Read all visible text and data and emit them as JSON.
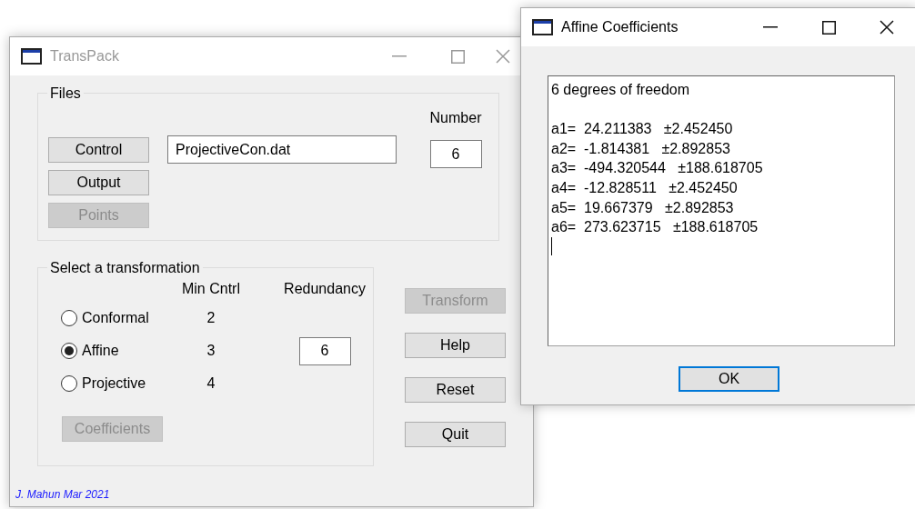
{
  "main_window": {
    "title": "TransPack",
    "active": false,
    "files_group": {
      "legend": "Files",
      "buttons": [
        {
          "label": "Control",
          "disabled": false
        },
        {
          "label": "Output",
          "disabled": false
        },
        {
          "label": "Points",
          "disabled": true
        }
      ],
      "file_field": {
        "value": "ProjectiveCon.dat"
      },
      "number": {
        "label": "Number",
        "value": "6"
      }
    },
    "transformation_group": {
      "legend": "Select a transformation",
      "columns": [
        "Min Cntrl",
        "Redundancy"
      ],
      "options": [
        {
          "label": "Conformal",
          "min_control": "2",
          "selected": false
        },
        {
          "label": "Affine",
          "min_control": "3",
          "selected": true
        },
        {
          "label": "Projective",
          "min_control": "4",
          "selected": false
        }
      ],
      "redundancy_value": "6",
      "coefficients_button": {
        "label": "Coefficients",
        "disabled": true
      }
    },
    "actions": [
      {
        "label": "Transform",
        "disabled": true
      },
      {
        "label": "Help",
        "disabled": false
      },
      {
        "label": "Reset",
        "disabled": false
      },
      {
        "label": "Quit",
        "disabled": false
      }
    ],
    "footer": "J. Mahun Mar 2021"
  },
  "coefficients_window": {
    "title": "Affine Coefficients",
    "active": true,
    "heading": "6 degrees of freedom",
    "lines": [
      "a1=  24.211383   ±2.452450",
      "a2=  -1.814381   ±2.892853",
      "a3=  -494.320544   ±188.618705",
      "a4=  -12.828511   ±2.452450",
      "a5=  19.667379   ±2.892853",
      "a6=  273.623715   ±188.618705"
    ],
    "ok_button": "OK"
  }
}
